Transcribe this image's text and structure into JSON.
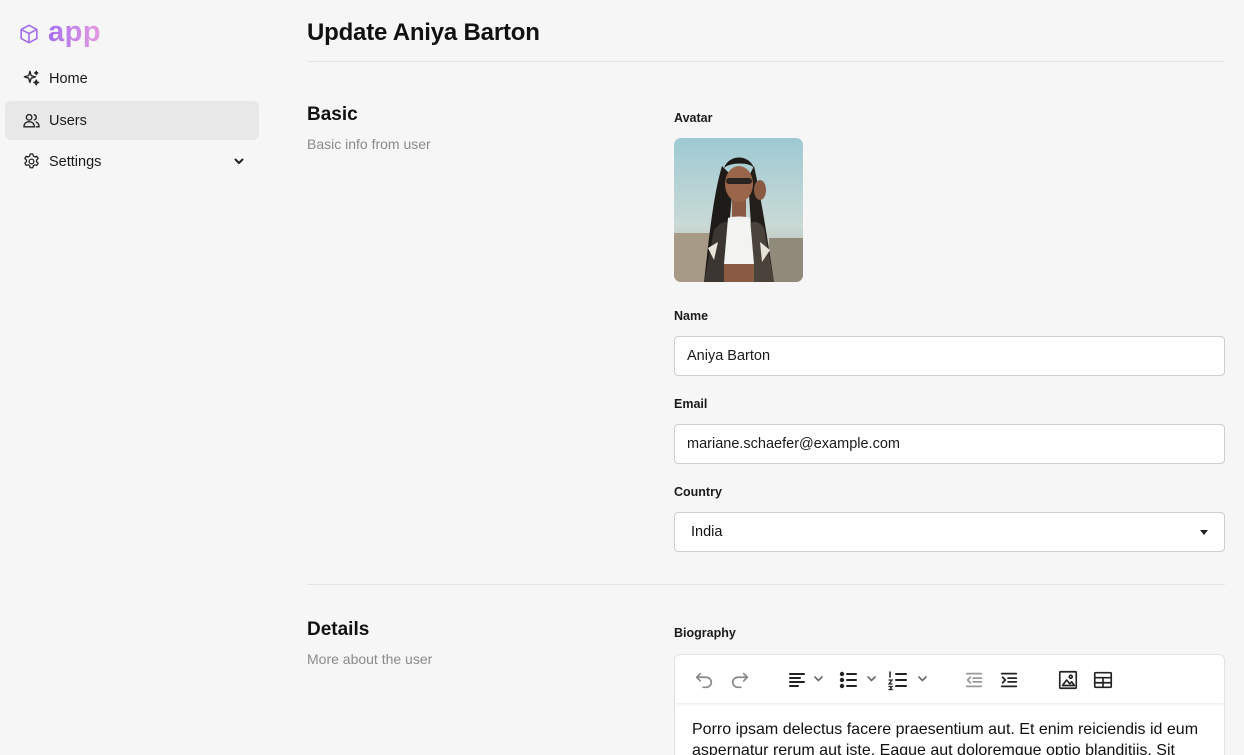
{
  "app": {
    "name": "app"
  },
  "sidebar": {
    "items": [
      {
        "label": "Home",
        "icon": "sparkles-icon"
      },
      {
        "label": "Users",
        "icon": "users-icon",
        "active": true
      },
      {
        "label": "Settings",
        "icon": "gear-icon",
        "expandable": true
      }
    ]
  },
  "page": {
    "title": "Update Aniya Barton"
  },
  "basic": {
    "title": "Basic",
    "description": "Basic info from user",
    "avatar_label": "Avatar",
    "name_label": "Name",
    "name_value": "Aniya Barton",
    "email_label": "Email",
    "email_value": "mariane.schaefer@example.com",
    "country_label": "Country",
    "country_value": "India"
  },
  "details": {
    "title": "Details",
    "description": "More about the user",
    "biography_label": "Biography",
    "biography_text": "Porro ipsam delectus facere praesentium aut. Et enim reiciendis id eum aspernatur rerum aut iste. Eaque aut doloremque optio blanditiis. Sit"
  },
  "toolbar": {
    "buttons": [
      "undo-icon",
      "redo-icon",
      "align-left-icon",
      "bullet-list-icon",
      "numbered-list-icon",
      "outdent-icon",
      "indent-icon",
      "image-icon",
      "table-icon"
    ]
  },
  "colors": {
    "brand_start": "#a66ff0",
    "brand_end": "#e79ce0",
    "active_nav": "#e8e8e8"
  }
}
